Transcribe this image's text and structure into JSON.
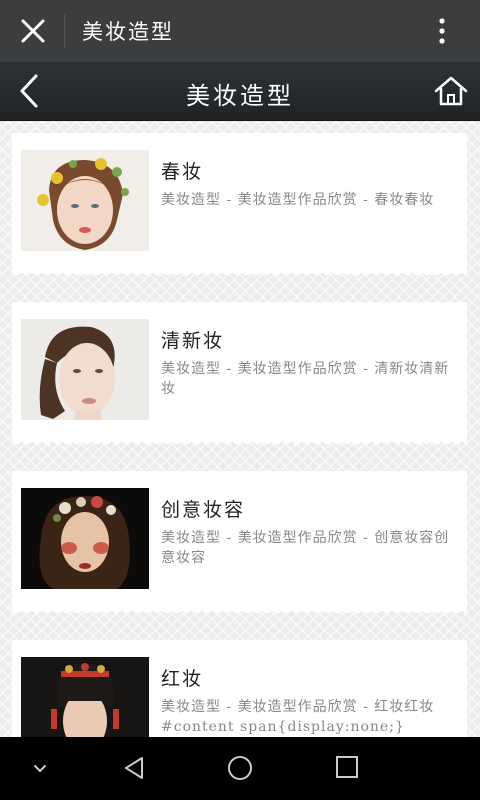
{
  "topbar": {
    "title": "美妆造型"
  },
  "header": {
    "title": "美妆造型"
  },
  "items": [
    {
      "title": "春妆",
      "description": "美妆造型 - 美妆造型作品欣赏 - 春妆春妆"
    },
    {
      "title": "清新妆",
      "description": "美妆造型 - 美妆造型作品欣赏 - 清新妆清新妆"
    },
    {
      "title": "创意妆容",
      "description": "美妆造型 - 美妆造型作品欣赏 - 创意妆容创意妆容"
    },
    {
      "title": "红妆",
      "description": "美妆造型 - 美妆造型作品欣赏 - 红妆红妆#content span{display:none;}"
    }
  ],
  "icons": {
    "close": "close-icon",
    "more": "more-vert-icon",
    "back": "chevron-left-icon",
    "home": "home-icon",
    "nav_down": "chevron-down-icon",
    "nav_back": "triangle-back-icon",
    "nav_home": "circle-home-icon",
    "nav_recent": "square-recent-icon"
  },
  "colors": {
    "topbar": "#3c3d3f",
    "header": "#272b2d",
    "background": "#ececec",
    "desc_text": "#888888"
  }
}
